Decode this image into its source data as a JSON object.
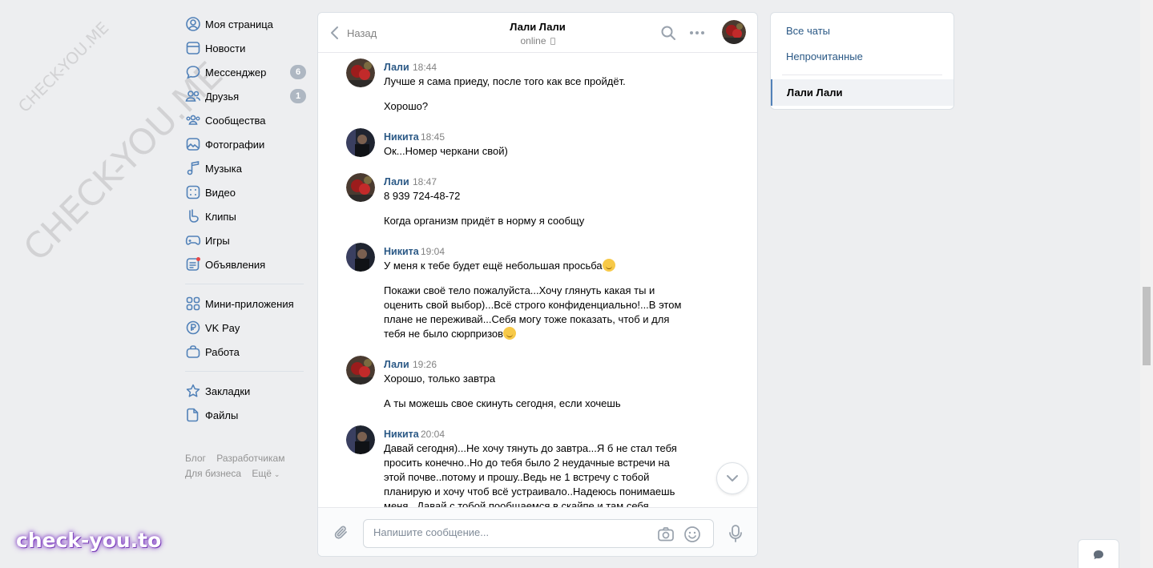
{
  "nav": {
    "items": [
      {
        "label": "Моя страница",
        "icon": "user-circle-icon"
      },
      {
        "label": "Новости",
        "icon": "newspaper-icon"
      },
      {
        "label": "Мессенджер",
        "icon": "message-bubble-icon",
        "badge": "6"
      },
      {
        "label": "Друзья",
        "icon": "friends-icon",
        "badge": "1"
      },
      {
        "label": "Сообщества",
        "icon": "communities-icon"
      },
      {
        "label": "Фотографии",
        "icon": "photo-icon"
      },
      {
        "label": "Музыка",
        "icon": "music-note-icon"
      },
      {
        "label": "Видео",
        "icon": "video-icon"
      },
      {
        "label": "Клипы",
        "icon": "clips-icon"
      },
      {
        "label": "Игры",
        "icon": "gamepad-icon"
      },
      {
        "label": "Объявления",
        "icon": "ads-icon"
      }
    ],
    "items2": [
      {
        "label": "Мини-приложения",
        "icon": "apps-grid-icon"
      },
      {
        "label": "VK Pay",
        "icon": "vkpay-icon"
      },
      {
        "label": "Работа",
        "icon": "briefcase-icon"
      }
    ],
    "items3": [
      {
        "label": "Закладки",
        "icon": "star-icon"
      },
      {
        "label": "Файлы",
        "icon": "file-icon"
      }
    ],
    "footer": {
      "blog": "Блог",
      "devs": "Разработчикам",
      "business": "Для бизнеса",
      "more": "Ещё"
    }
  },
  "watermark": {
    "large": "CHECK-YOU.ME",
    "small": "CHECK-YOU.ME",
    "brand": "check-you.to"
  },
  "chat": {
    "back_label": "Назад",
    "title": "Лали Лали",
    "status": "online",
    "messages": [
      {
        "author": "Лали",
        "time": "18:44",
        "texts": [
          "Лучше я сама приеду, после того как все пройдёт.",
          "Хорошо?"
        ]
      },
      {
        "author": "Никита",
        "time": "18:45",
        "texts": [
          "Ок...Номер черкани свой)"
        ]
      },
      {
        "author": "Лали",
        "time": "18:47",
        "texts": [
          "8 939 724-48-72",
          "Когда организм придёт в норму я сообщу"
        ]
      },
      {
        "author": "Никита",
        "time": "19:04",
        "texts": [
          "У меня к тебе будет ещё небольшая просьба",
          "Покажи своё тело пожалуйста...Хочу глянуть какая ты и оценить свой выбор)...Всё строго конфиденциально!...В этом плане не переживай...Себя могу тоже показать, чтоб и для тебя не было сюрпризов"
        ]
      },
      {
        "author": "Лали",
        "time": "19:26",
        "texts": [
          "Хорошо, только завтра",
          "А ты можешь свое скинуть сегодня, если хочешь"
        ]
      },
      {
        "author": "Никита",
        "time": "20:04",
        "texts": [
          "Давай сегодня)...Не хочу тянуть до завтра...Я б не стал тебя просить конечно..Но до тебя было 2 неудачные встречи на этой почве..потому и прошу..Ведь не 1 встречу с тобой планирую и хочу чтоб всё устраивало..Надеюсь понимаешь меня...Давай с тобой пообщаемся в скайпе и там себя"
        ]
      }
    ],
    "composer_placeholder": "Напишите сообщение..."
  },
  "right_panel": {
    "all_chats": "Все чаты",
    "unread": "Непрочитанные",
    "active_chat": "Лали Лали"
  },
  "colors": {
    "link": "#2a5885",
    "badge": "#aeb7c2",
    "accent": "#5181b8",
    "background": "#edeef0"
  }
}
